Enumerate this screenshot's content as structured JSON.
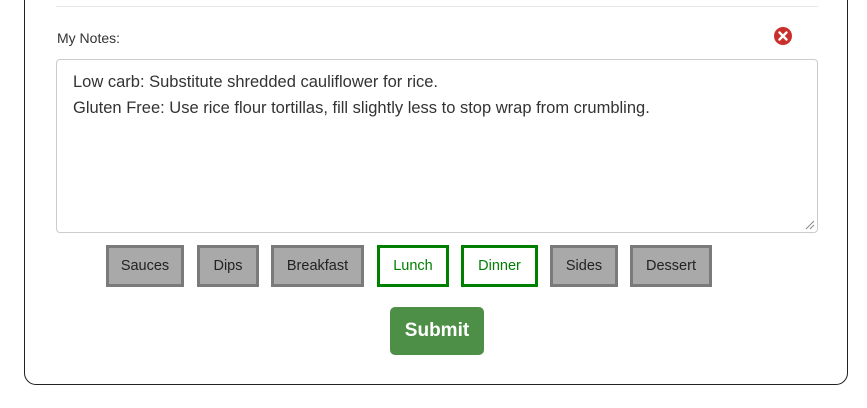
{
  "notes": {
    "label": "My Notes:",
    "text": "Low carb: Substitute shredded cauliflower for rice.\nGluten Free: Use rice flour tortillas, fill slightly less to stop wrap from crumbling."
  },
  "tags": [
    {
      "label": "Sauces",
      "active": false
    },
    {
      "label": "Dips",
      "active": false
    },
    {
      "label": "Breakfast",
      "active": false
    },
    {
      "label": "Lunch",
      "active": true
    },
    {
      "label": "Dinner",
      "active": true
    },
    {
      "label": "Sides",
      "active": false
    },
    {
      "label": "Dessert",
      "active": false
    }
  ],
  "submit_label": "Submit",
  "colors": {
    "active_tag": "#008000",
    "inactive_tag_bg": "#a9a9a9",
    "submit_bg": "#4d8f46",
    "close_icon": "#c9302c"
  },
  "icons": {
    "close": "close-icon"
  }
}
